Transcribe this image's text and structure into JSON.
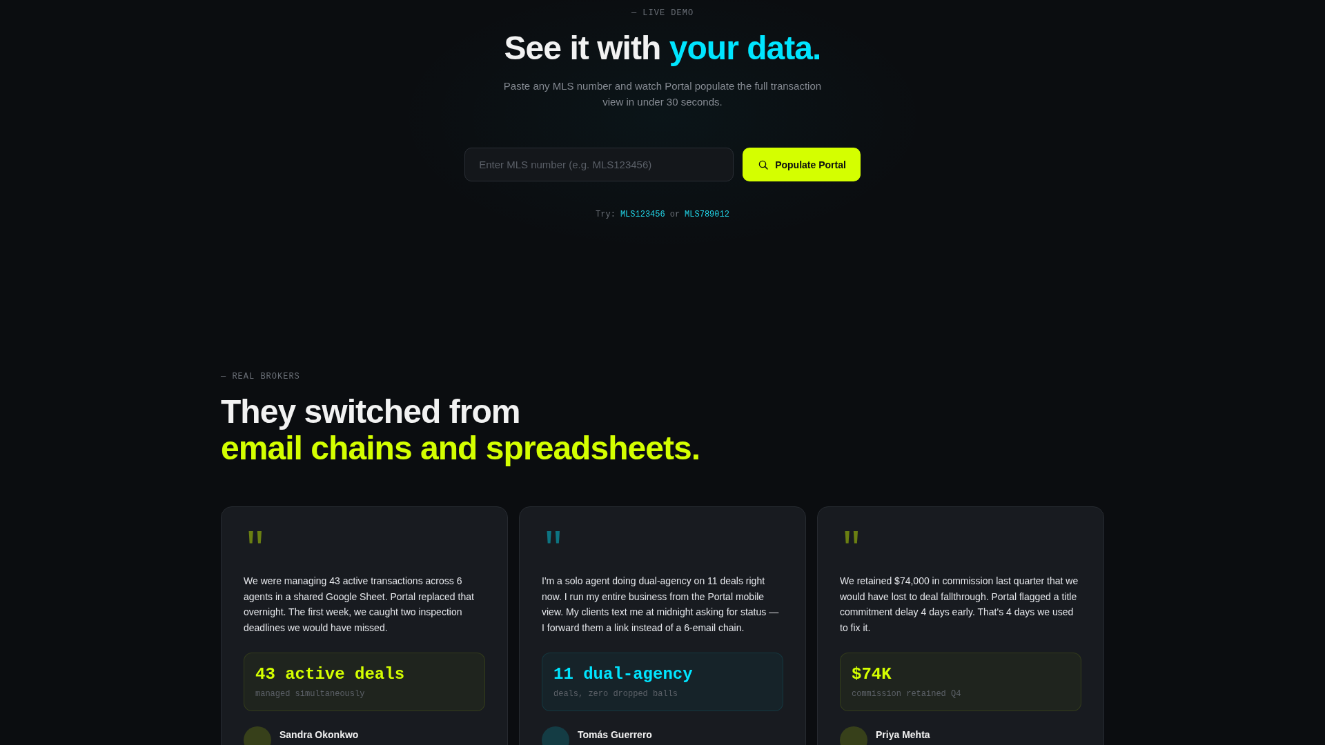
{
  "demo": {
    "eyebrow": "— LIVE DEMO",
    "title": {
      "text": "See it with",
      "highlight": "your data."
    },
    "subtitle": "Paste any MLS number and watch Portal populate the full transaction view in under 30 seconds.",
    "search": {
      "placeholder": "Enter MLS number (e.g. MLS123456)",
      "button": "Populate Portal"
    },
    "examples": {
      "label": "Try:",
      "items": [
        "MLS123456",
        "MLS789012"
      ],
      "separator": "or"
    }
  },
  "testimonials_section": {
    "eyebrow": "— REAL BROKERS",
    "title": {
      "text": "They switched from",
      "highlight": "email chains and spreadsheets."
    },
    "cards": [
      {
        "color": "#d4ff00",
        "quote_mark": "\"",
        "quote": "We were managing 43 active transactions across 6 agents in a shared Google Sheet. Portal replaced that overnight. The first week, we caught two inspection deadlines we would have missed.",
        "metric": "43 active deals",
        "metric_caption": "managed simultaneously",
        "name": "Sandra Okonkwo"
      },
      {
        "color": "#00e5ff",
        "quote_mark": "\"",
        "quote": "I'm a solo agent doing dual-agency on 11 deals right now. I run my entire business from the Portal mobile view. My clients text me at midnight asking for status — I forward them a link instead of a 6-email chain.",
        "metric": "11 dual-agency",
        "metric_caption": "deals, zero dropped balls",
        "name": "Tomás Guerrero"
      },
      {
        "color": "#d4ff00",
        "quote_mark": "\"",
        "quote": "We retained $74,000 in commission last quarter that we would have lost to deal fallthrough. Portal flagged a title commitment delay 4 days early. That's 4 days we used to fix it.",
        "metric": "$74K",
        "metric_caption": "commission retained Q4",
        "name": "Priya Mehta"
      }
    ]
  }
}
